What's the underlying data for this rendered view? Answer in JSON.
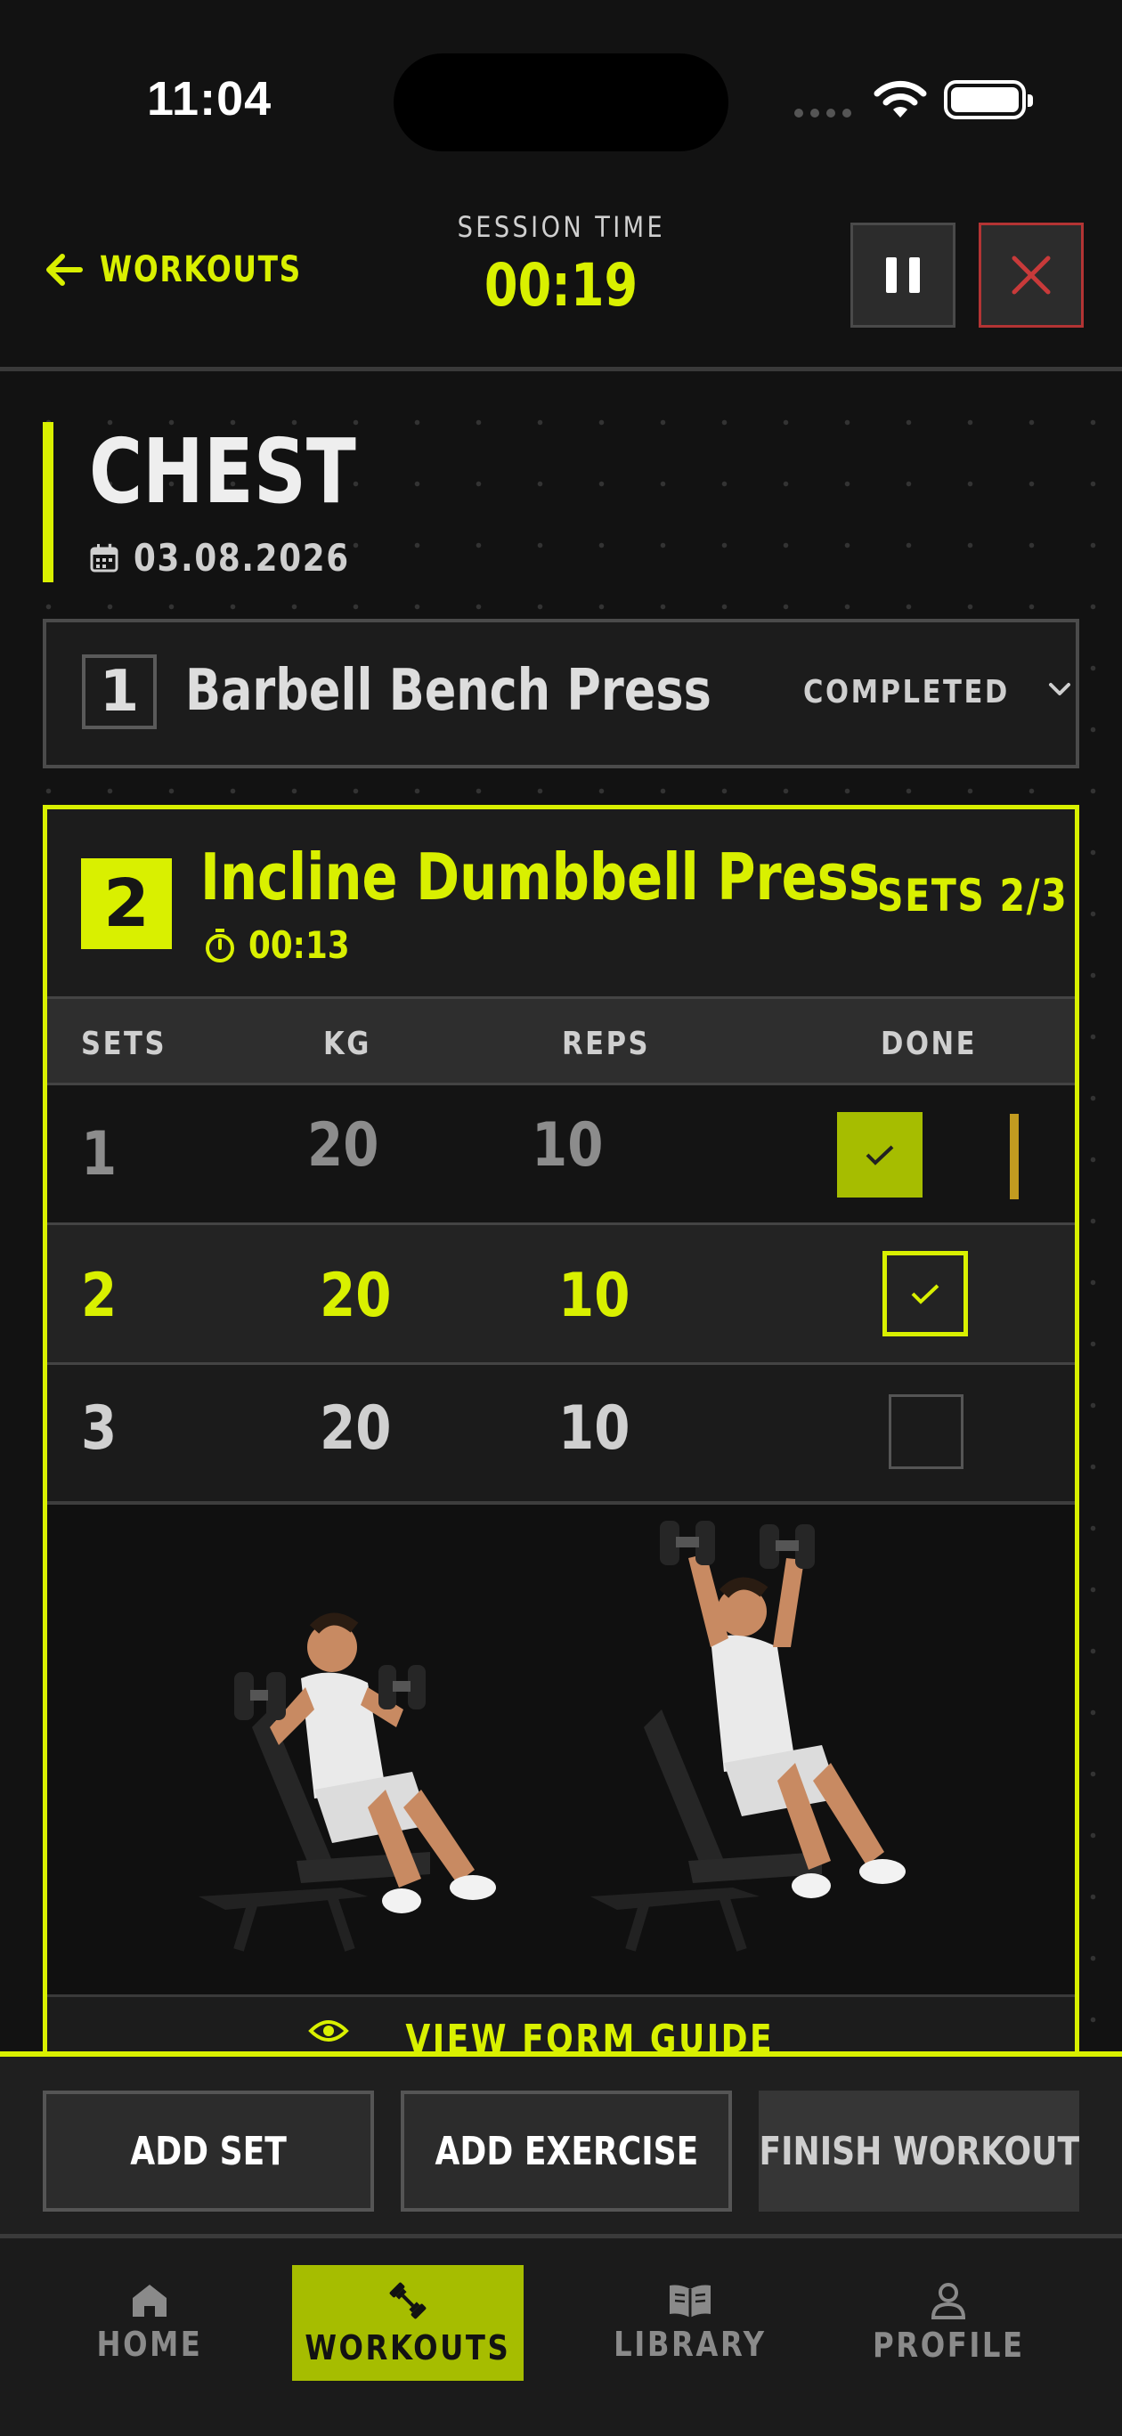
{
  "status_bar": {
    "time": "11:04"
  },
  "header": {
    "back_label": "WORKOUTS",
    "session_label": "SESSION TIME",
    "session_time": "00:19"
  },
  "workout": {
    "title": "CHEST",
    "date": "03.08.2026"
  },
  "exercise1": {
    "number": "1",
    "name": "Barbell Bench Press",
    "status": "COMPLETED"
  },
  "exercise2": {
    "number": "2",
    "name": "Incline Dumbbell Press",
    "timer": "00:13",
    "sets_progress": "SETS 2/3",
    "headers": {
      "sets": "SETS",
      "kg": "KG",
      "reps": "REPS",
      "done": "DONE"
    },
    "rows": [
      {
        "set": "1",
        "kg": "20",
        "reps": "10",
        "done": true
      },
      {
        "set": "2",
        "kg": "20",
        "reps": "10",
        "done": true
      },
      {
        "set": "3",
        "kg": "20",
        "reps": "10",
        "done": false
      }
    ],
    "guide_label": "VIEW FORM GUIDE"
  },
  "actions": {
    "add_set": "ADD SET",
    "add_exercise": "ADD EXERCISE",
    "finish": "FINISH WORKOUT"
  },
  "tabs": [
    {
      "label": "HOME",
      "icon": "home-icon"
    },
    {
      "label": "WORKOUTS",
      "icon": "dumbbell-icon",
      "active": true
    },
    {
      "label": "LIBRARY",
      "icon": "book-icon"
    },
    {
      "label": "PROFILE",
      "icon": "person-icon"
    }
  ],
  "colors": {
    "accent": "#d9f000",
    "accent_dark": "#a6bd00",
    "danger": "#b33434",
    "background": "#121212"
  }
}
